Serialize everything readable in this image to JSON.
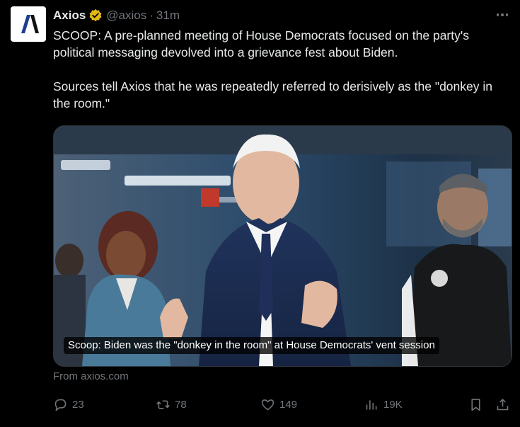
{
  "author": {
    "name": "Axios",
    "handle": "@axios",
    "separator": "·",
    "time": "31m",
    "avatar_letter": "A"
  },
  "tweet": {
    "paragraph1": "SCOOP: A pre-planned meeting of House Democrats focused on the party's political messaging devolved into a grievance fest about Biden.",
    "paragraph2": "Sources tell Axios that he was repeatedly referred to derisively as the \"donkey in the room.\""
  },
  "card": {
    "headline": "Scoop: Biden was the \"donkey in the room\" at House Democrats' vent session",
    "source": "From axios.com"
  },
  "actions": {
    "replies": "23",
    "reposts": "78",
    "likes": "149",
    "views": "19K"
  },
  "icons": {
    "verified": "verified-badge-icon",
    "more": "more-dots-icon",
    "reply": "reply-bubble-icon",
    "repost": "repost-arrows-icon",
    "like": "heart-icon",
    "views": "views-bars-icon",
    "bookmark": "bookmark-icon",
    "share": "share-upload-icon"
  },
  "colors": {
    "background": "#000000",
    "text": "#e7e9ea",
    "muted": "#71767b",
    "verified_gold": "#e2b719",
    "axios_blue": "#1c3f8f"
  }
}
